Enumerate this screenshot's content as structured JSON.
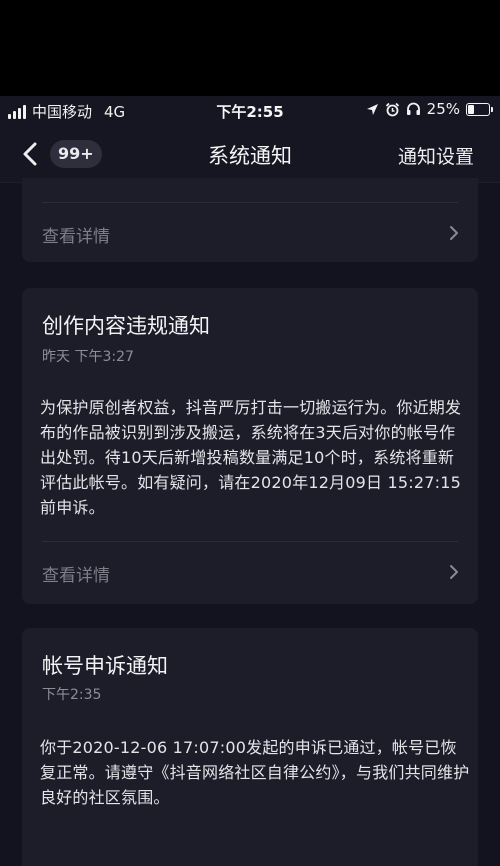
{
  "status_bar": {
    "carrier": "中国移动",
    "network": "4G",
    "time": "下午2:55",
    "battery": "25%",
    "battery_level": 0.25,
    "icons": [
      "signal-icon",
      "location-icon",
      "alarm-icon",
      "headphones-icon",
      "battery-icon"
    ]
  },
  "nav": {
    "unread_badge": "99+",
    "title": "系统通知",
    "settings_label": "通知设置",
    "icons": [
      "back-chevron-icon"
    ]
  },
  "cards": [
    {
      "detail_label": "查看详情"
    },
    {
      "title": "创作内容违规通知",
      "time": "昨天 下午3:27",
      "body": "为保护原创者权益，抖音严厉打击一切搬运行为。你近期发布的作品被识别到涉及搬运，系统将在3天后对你的帐号作出处罚。待10天后新增投稿数量满足10个时，系统将重新评估此帐号。如有疑问，请在2020年12月09日 15:27:15前申诉。",
      "detail_label": "查看详情"
    },
    {
      "title": "帐号申诉通知",
      "time": "下午2:35",
      "body": "你于2020-12-06 17:07:00发起的申诉已通过，帐号已恢复正常。请遵守《抖音网络社区自律公约》，与我们共同维护良好的社区氛围。"
    }
  ],
  "colors": {
    "background": "#131320",
    "card": "#1d1d2a",
    "muted_text": "#7e7e89",
    "primary_text": "#f3f3f5"
  }
}
